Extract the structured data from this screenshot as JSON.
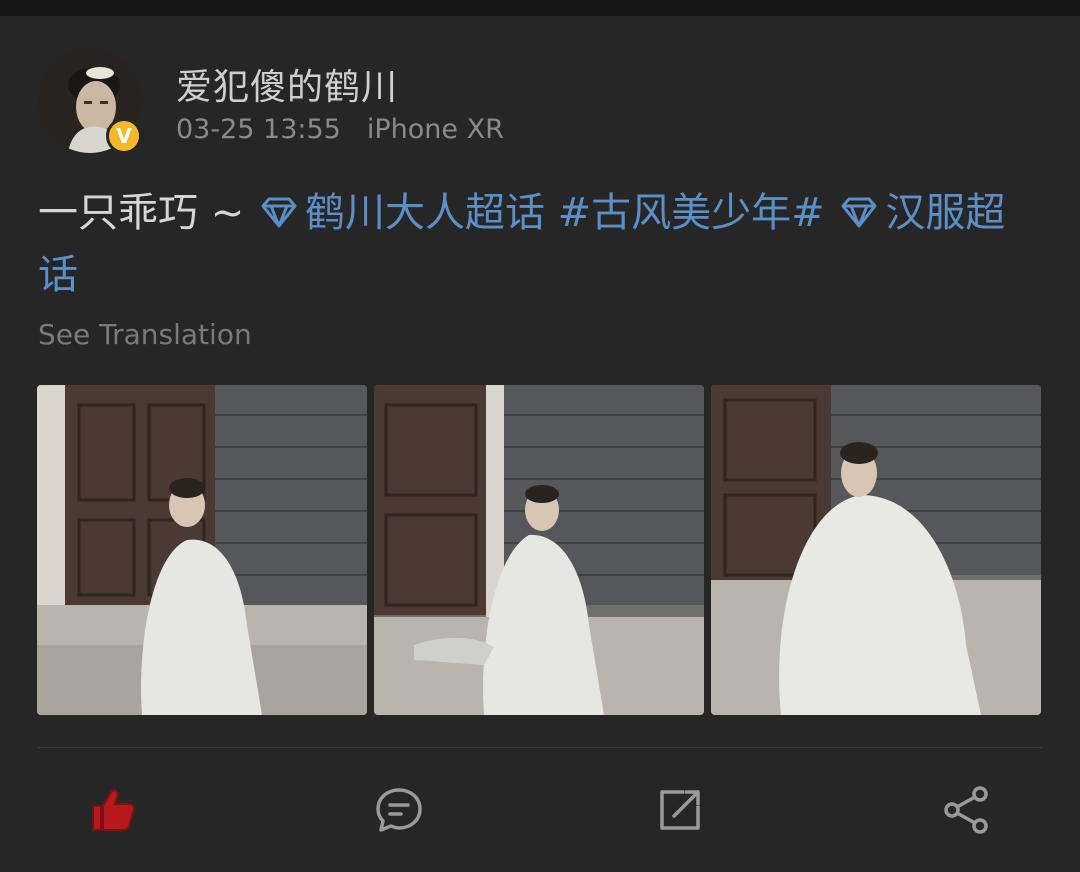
{
  "post": {
    "author": {
      "name": "爱犯傻的鹤川",
      "verified_badge": "V"
    },
    "timestamp": "03-25 13:55",
    "device": "iPhone XR",
    "text": {
      "prefix": "一只乖巧 ~ ",
      "topic1": "鹤川大人超话",
      "hashtag": " #古风美少年# ",
      "topic2": "汉服超话"
    },
    "see_translation": "See Translation",
    "photos": [
      {
        "alt": "photo-1"
      },
      {
        "alt": "photo-2"
      },
      {
        "alt": "photo-3"
      }
    ]
  },
  "actions": [
    {
      "name": "like",
      "icon": "thumbs-up-icon",
      "color": "#b7191c"
    },
    {
      "name": "comment",
      "icon": "comment-icon",
      "color": "#9a9a9a"
    },
    {
      "name": "repost",
      "icon": "repost-icon",
      "color": "#9a9a9a"
    },
    {
      "name": "share",
      "icon": "share-icon",
      "color": "#9a9a9a"
    }
  ],
  "colors": {
    "background": "#262626",
    "topic_link": "#5b8fc7",
    "badge": "#f3b92a"
  }
}
